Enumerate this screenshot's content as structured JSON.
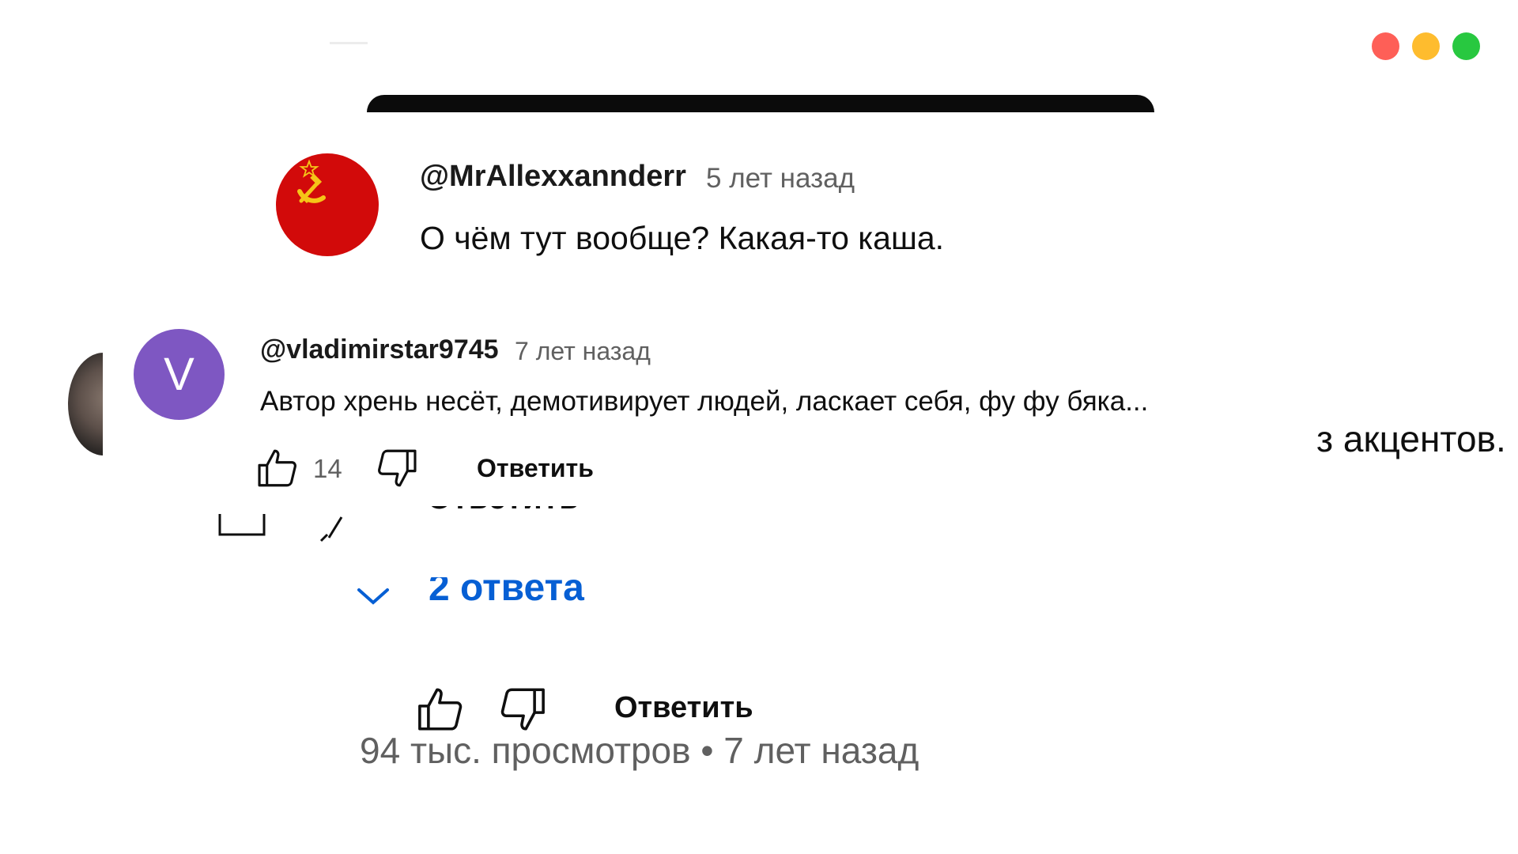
{
  "window": {
    "traffic_lights": {
      "close": "#fe5f57",
      "minimize": "#febc2e",
      "maximize": "#28c840"
    }
  },
  "comments": [
    {
      "author": "@MrAllexxannderr",
      "time": "5 лет назад",
      "text": "О чём тут вообще? Какая-то каша.",
      "avatar_icon": "ussr-flag-icon",
      "avatar_color": "#d20a0a"
    },
    {
      "author": "@vladimirstar9745",
      "time": "7 лет назад",
      "text": "Автор хрень несёт, демотивирует людей, ласкает себя, фу фу бяка...",
      "avatar_letter": "V",
      "avatar_color": "#7e57c2",
      "likes": "14",
      "reply_label": "Ответить"
    }
  ],
  "background_layer": {
    "text_fragment": "з акцентов.",
    "replies_toggle": "2 ответа",
    "reply_label": "Ответить",
    "video_meta": "94 тыс. просмотров • 7 лет назад",
    "ghost_text": "Ответить",
    "link_color": "#065fd4"
  }
}
